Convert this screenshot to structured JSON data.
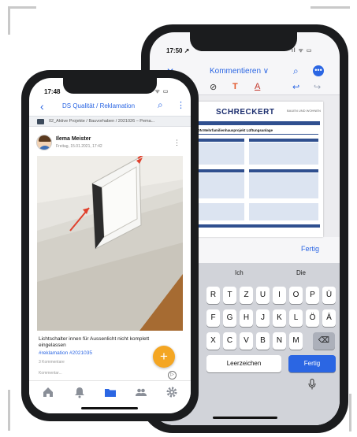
{
  "colors": {
    "accent": "#2b66e3",
    "fab": "#f4a623",
    "doc_blue": "#2f4f8f"
  },
  "back_phone": {
    "status": {
      "time": "17:50 ↗",
      "icons": "ıl ᯤ ▭"
    },
    "nav": {
      "close_icon": "close-icon",
      "title": "Kommentieren ∨",
      "search_icon": "search-icon",
      "more_icon": "ellipsis-icon"
    },
    "toolbar": {
      "tools": [
        "⊘",
        "T",
        "A"
      ],
      "undo": "↩",
      "redo": "↪"
    },
    "document": {
      "logo": "SCHRECKERT",
      "logo_right": "BAUEN UND WOHNEN",
      "heading": "REKLAMATION Mehrfamilienhausprojekt Lüftungsanlage"
    },
    "done_label": "Fertig",
    "keyboard": {
      "suggestions": [
        "Ich",
        "Die"
      ],
      "row1": [
        "R",
        "T",
        "Z",
        "U",
        "I",
        "O",
        "P",
        "Ü"
      ],
      "row2": [
        "F",
        "G",
        "H",
        "J",
        "K",
        "L",
        "Ö",
        "Ä"
      ],
      "row3": [
        "X",
        "C",
        "V",
        "B",
        "N",
        "M"
      ],
      "delete_icon": "⌫",
      "space_label": "Leerzeichen",
      "return_label": "Fertig",
      "mic_icon": "microphone-icon"
    }
  },
  "front_phone": {
    "status": {
      "time": "17:48",
      "icons": "ıl ᯤ ▭"
    },
    "nav": {
      "back_icon": "back-chevron-icon",
      "title": "DS Qualität / Reklamation",
      "search_icon": "search-icon",
      "menu_icon": "more-vertical-icon"
    },
    "path": "02_Aktive Projekte / Bauvorhaben / 2021026 – Pema...",
    "post": {
      "user": "Ilema Meister",
      "date": "Freitag, 15.01.2021, 17:42",
      "caption": "Lichtschalter innen für Aussenlicht nicht komplett eingelassen",
      "tag": "#reklamation #2021035",
      "meta": "3 Kommentare",
      "comment_placeholder": "Kommentar..."
    },
    "fab_label": "+",
    "tabs": [
      "home-icon",
      "notifications-bell-icon",
      "folder-icon",
      "team-icon",
      "settings-gear-icon"
    ]
  }
}
